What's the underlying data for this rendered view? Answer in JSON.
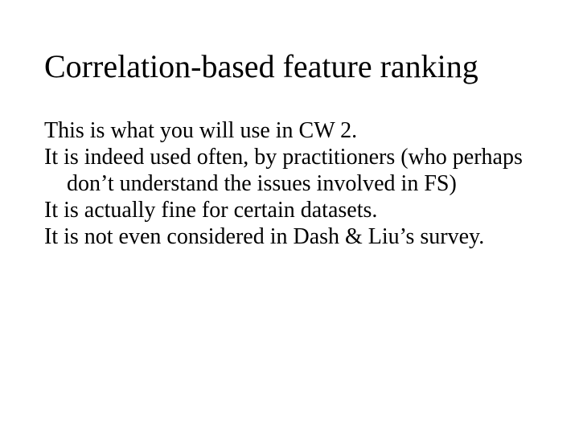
{
  "title": "Correlation-based feature ranking",
  "paragraphs": [
    "This is what you will use in CW 2.",
    "It is indeed used often, by practitioners (who perhaps don’t understand the issues involved in FS)",
    "It is actually fine for certain datasets.",
    "It is not even considered in Dash & Liu’s survey."
  ]
}
